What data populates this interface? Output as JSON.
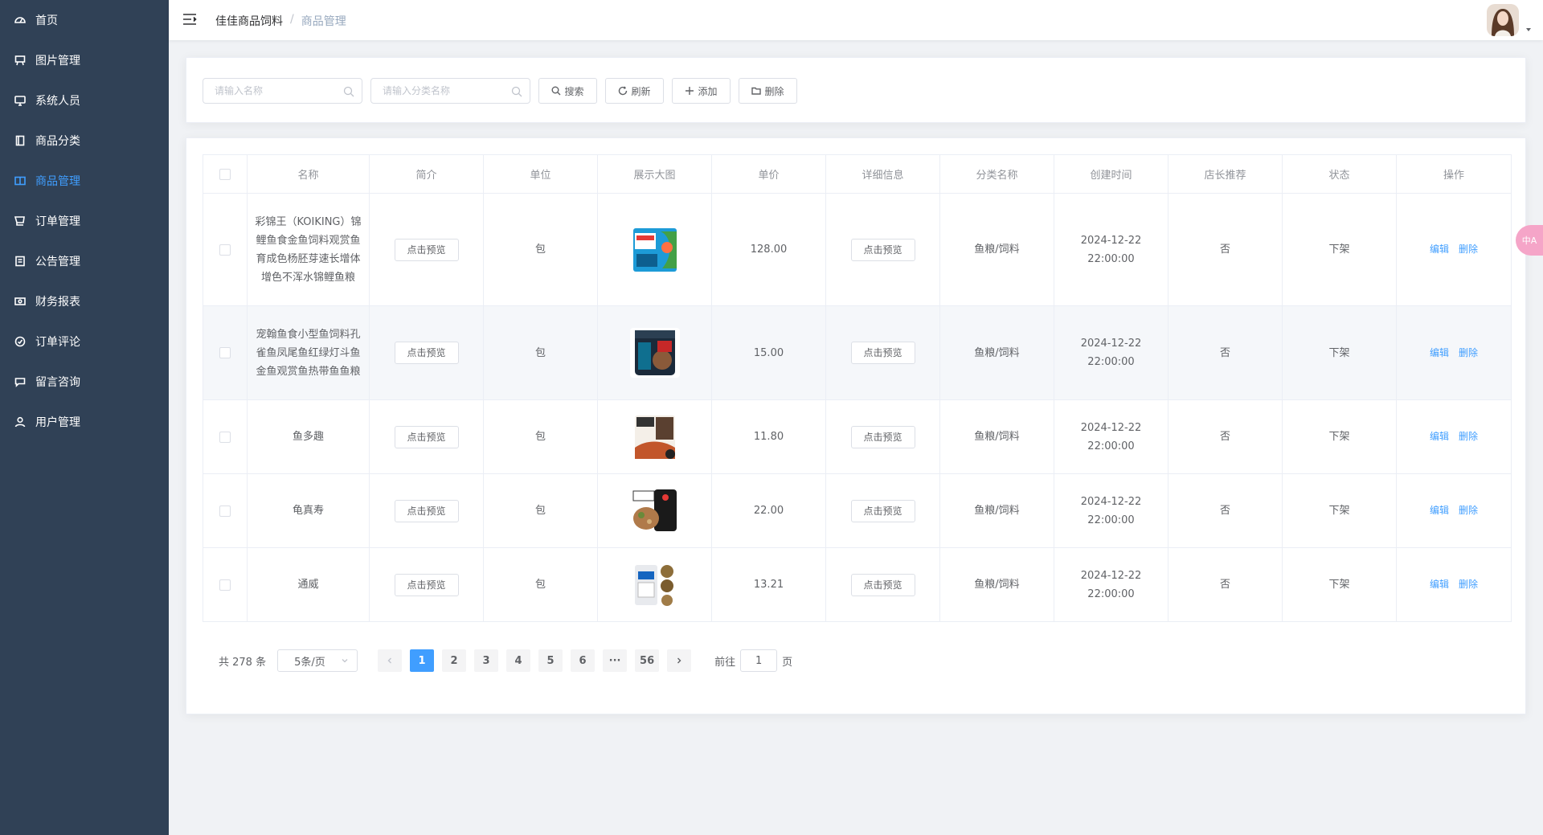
{
  "sidebar": {
    "items": [
      {
        "label": "首页",
        "icon": "dashboard-icon"
      },
      {
        "label": "图片管理",
        "icon": "picture-icon"
      },
      {
        "label": "系统人员",
        "icon": "monitor-icon"
      },
      {
        "label": "商品分类",
        "icon": "document-icon"
      },
      {
        "label": "商品管理",
        "icon": "tabs-icon",
        "active": true
      },
      {
        "label": "订单管理",
        "icon": "cart-icon"
      },
      {
        "label": "公告管理",
        "icon": "notice-icon"
      },
      {
        "label": "财务报表",
        "icon": "money-icon"
      },
      {
        "label": "订单评论",
        "icon": "comment-icon"
      },
      {
        "label": "留言咨询",
        "icon": "message-icon"
      },
      {
        "label": "用户管理",
        "icon": "user-icon"
      }
    ],
    "active_color": "#409eff",
    "bg_color": "#304156"
  },
  "header": {
    "breadcrumb_home": "佳佳商品饲料",
    "breadcrumb_sep": "/",
    "breadcrumb_current": "商品管理"
  },
  "search": {
    "name_placeholder": "请输入名称",
    "category_placeholder": "请输入分类名称",
    "search_label": "搜索",
    "refresh_label": "刷新",
    "add_label": "添加",
    "delete_label": "删除"
  },
  "table": {
    "columns": [
      "名称",
      "简介",
      "单位",
      "展示大图",
      "单价",
      "详细信息",
      "分类名称",
      "创建时间",
      "店长推荐",
      "状态",
      "操作"
    ],
    "preview_label": "点击预览",
    "edit_label": "编辑",
    "delete_label": "删除",
    "rows": [
      {
        "name": "彩锦王（KOIKING）锦鲤鱼食金鱼饲料观赏鱼育成色杨胚芽速长增体增色不浑水锦鲤鱼粮",
        "unit": "包",
        "image": "koi-food-bag",
        "price": "128.00",
        "category": "鱼粮/饲料",
        "created": "2024-12-22 22:00:00",
        "recommend": "否",
        "status": "下架"
      },
      {
        "name": "宠翰鱼食小型鱼饲料孔雀鱼凤尾鱼红绿灯斗鱼金鱼观赏鱼热带鱼鱼粮",
        "unit": "包",
        "image": "tropical-fish-food-can",
        "price": "15.00",
        "category": "鱼粮/饲料",
        "created": "2024-12-22 22:00:00",
        "recommend": "否",
        "status": "下架"
      },
      {
        "name": "鱼多趣",
        "unit": "包",
        "image": "fish-food-pack",
        "price": "11.80",
        "category": "鱼粮/饲料",
        "created": "2024-12-22 22:00:00",
        "recommend": "否",
        "status": "下架"
      },
      {
        "name": "龟真寿",
        "unit": "包",
        "image": "turtle-food-jar",
        "price": "22.00",
        "category": "鱼粮/饲料",
        "created": "2024-12-22 22:00:00",
        "recommend": "否",
        "status": "下架"
      },
      {
        "name": "通威",
        "unit": "包",
        "image": "tongwei-feed-bag",
        "price": "13.21",
        "category": "鱼粮/饲料",
        "created": "2024-12-22 22:00:00",
        "recommend": "否",
        "status": "下架"
      }
    ]
  },
  "pagination": {
    "total_text": "共 278 条",
    "page_size": "5条/页",
    "pages": [
      "1",
      "2",
      "3",
      "4",
      "5",
      "6",
      "···",
      "56"
    ],
    "current": "1",
    "goto_label": "前往",
    "goto_value": "1",
    "page_suffix": "页"
  },
  "float_bubble": "中A"
}
